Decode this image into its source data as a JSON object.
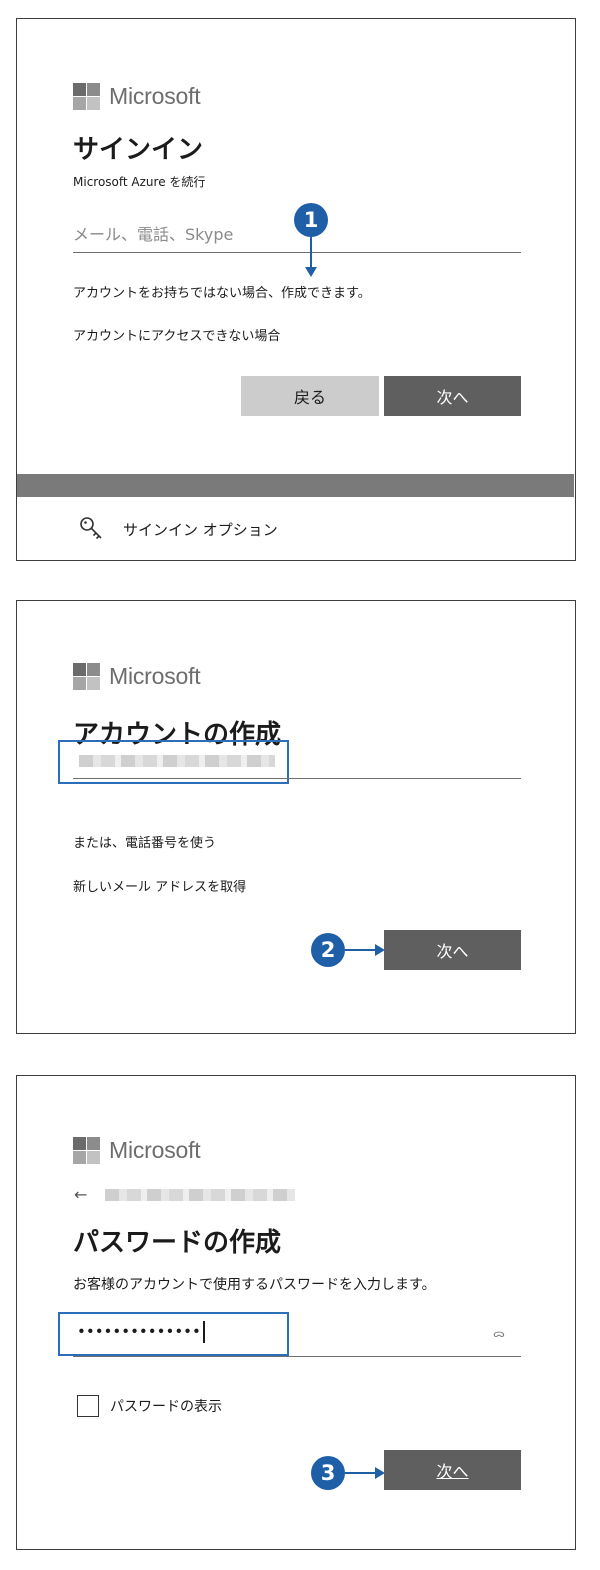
{
  "brand": {
    "name": "Microsoft"
  },
  "signin": {
    "title": "サインイン",
    "subtitle": "Microsoft Azure を続行",
    "email_placeholder": "メール、電話、Skype",
    "create_account_text": "アカウントをお持ちではない場合、作成できます。",
    "cant_access_link": "アカウントにアクセスできない場合",
    "back_button": "戻る",
    "next_button": "次へ",
    "options_label": "サインイン オプション",
    "step_badge": "1"
  },
  "create_account": {
    "title": "アカウントの作成",
    "use_phone_link": "または、電話番号を使う",
    "new_email_link": "新しいメール アドレスを取得",
    "next_button": "次へ",
    "step_badge": "2"
  },
  "create_password": {
    "back_arrow": "←",
    "title": "パスワードの作成",
    "description": "お客様のアカウントで使用するパスワードを入力します。",
    "password_value": "••••••••••••••",
    "reveal_icon": "ᯅ",
    "show_password_label": "パスワードの表示",
    "next_button": "次へ",
    "step_badge": "3"
  },
  "colors": {
    "accent_blue": "#1e5fa8",
    "highlight_blue": "#2a6fb8",
    "primary_button": "#5f5f5f",
    "secondary_button": "#cccccc",
    "band_gray": "#7a7a7a"
  },
  "icons": {
    "brand_logo": "microsoft-logo-icon",
    "options": "key-icon",
    "back": "back-arrow-icon",
    "reveal": "reveal-password-icon"
  }
}
